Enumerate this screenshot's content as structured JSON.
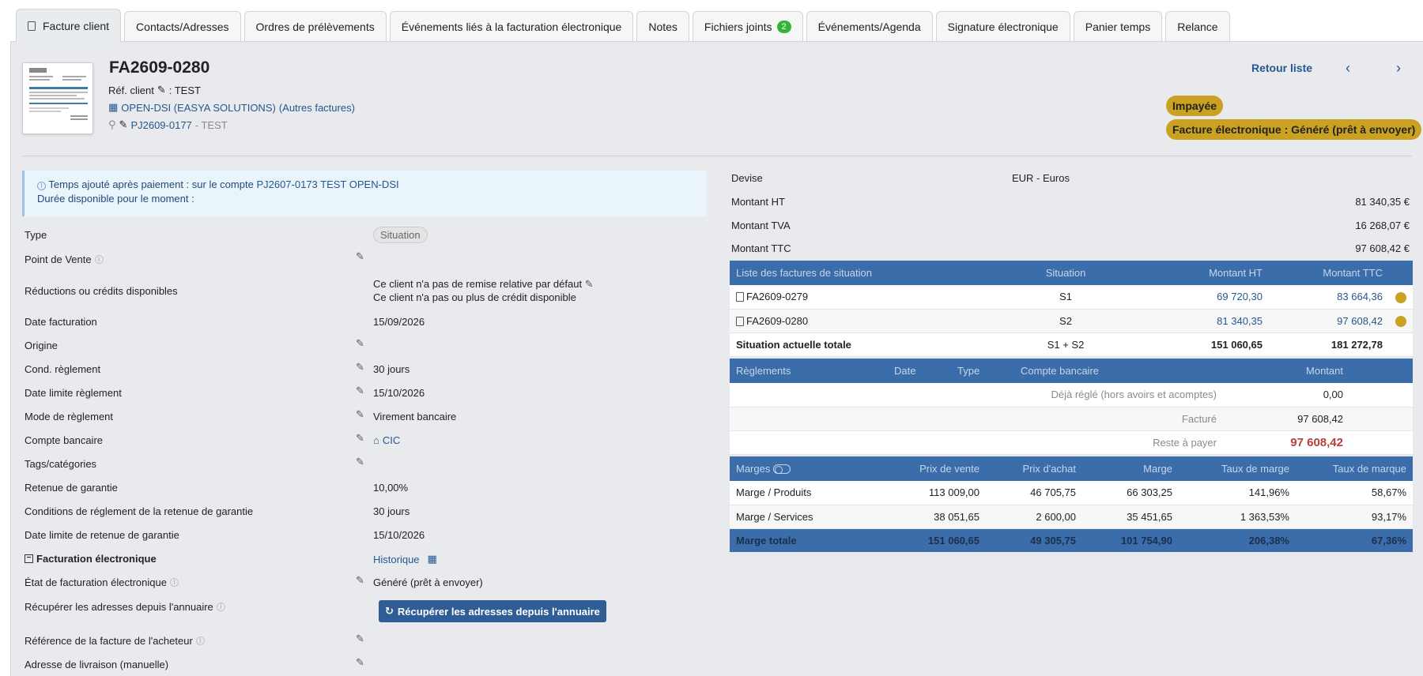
{
  "tabs": [
    {
      "label": "Facture client",
      "active": true
    },
    {
      "label": "Contacts/Adresses"
    },
    {
      "label": "Ordres de prélèvements"
    },
    {
      "label": "Événements liés à la facturation électronique"
    },
    {
      "label": "Notes"
    },
    {
      "label": "Fichiers joints",
      "count": "2"
    },
    {
      "label": "Événements/Agenda"
    },
    {
      "label": "Signature électronique"
    },
    {
      "label": "Panier temps"
    },
    {
      "label": "Relance"
    }
  ],
  "header": {
    "ref": "FA2609-0280",
    "ref_client_label": "Réf. client",
    "ref_client_value": ": TEST",
    "company": "OPEN-DSI (EASYA SOLUTIONS)",
    "other_invoices": "(Autres factures)",
    "project_ref": "PJ2609-0177",
    "project_name": "- TEST",
    "back_link": "Retour liste",
    "prev_icon": "chevron-left-icon",
    "next_icon": "chevron-right-icon",
    "status": "Impayée",
    "einvoice_status": "Facture électronique : Généré (prêt à envoyer)",
    "status_color": "#caa121"
  },
  "info": {
    "line1_prefix": "Temps ajouté après paiement : sur le compte",
    "line1_link": "PJ2607-0173 TEST OPEN-DSI",
    "line2": "Durée disponible pour le moment :"
  },
  "fields": {
    "type_label": "Type",
    "type_value": "Situation",
    "pos_label": "Point de Vente",
    "discount_label": "Réductions ou crédits disponibles",
    "discount_line1": "Ce client n'a pas de remise relative par défaut",
    "discount_line2": "Ce client n'a pas ou plus de crédit disponible",
    "date_label": "Date facturation",
    "date_value": "15/09/2026",
    "origin_label": "Origine",
    "cond_label": "Cond. règlement",
    "cond_value": "30 jours",
    "due_label": "Date limite règlement",
    "due_value": "15/10/2026",
    "mode_label": "Mode de règlement",
    "mode_value": "Virement bancaire",
    "bank_label": "Compte bancaire",
    "bank_value": "CIC",
    "tags_label": "Tags/catégories",
    "ret_label": "Retenue de garantie",
    "ret_value": "10,00%",
    "retcond_label": "Conditions de réglement de la retenue de garantie",
    "retcond_value": "30 jours",
    "retdate_label": "Date limite de retenue de garantie",
    "retdate_value": "15/10/2026",
    "einv_section": "Facturation électronique",
    "einv_history": "Historique",
    "einv_state_label": "État de facturation électronique",
    "einv_state_value": "Généré (prêt à envoyer)",
    "fetch_label": "Récupérer les adresses depuis l'annuaire",
    "fetch_button": "Récupérer les adresses depuis l'annuaire",
    "buyerref_label": "Référence de la facture de l'acheteur",
    "delivery_label": "Adresse de livraison (manuelle)"
  },
  "amounts": {
    "currency_label": "Devise",
    "currency_value": "EUR - Euros",
    "ht_label": "Montant HT",
    "ht_value": "81 340,35 €",
    "tva_label": "Montant TVA",
    "tva_value": "16 268,07 €",
    "ttc_label": "Montant TTC",
    "ttc_value": "97 608,42 €"
  },
  "situations": {
    "headers": [
      "Liste des factures de situation",
      "Situation",
      "Montant HT",
      "Montant TTC"
    ],
    "rows": [
      {
        "ref": "FA2609-0279",
        "situation": "S1",
        "ht": "69 720,30",
        "ttc": "83 664,36"
      },
      {
        "ref": "FA2609-0280",
        "situation": "S2",
        "ht": "81 340,35",
        "ttc": "97 608,42"
      }
    ],
    "total": {
      "label": "Situation actuelle totale",
      "situation": "S1 + S2",
      "ht": "151 060,65",
      "ttc": "181 272,78"
    }
  },
  "payments": {
    "headers": [
      "Règlements",
      "Date",
      "Type",
      "Compte bancaire",
      "Montant"
    ],
    "rows": [
      {
        "label": "Déjà réglé (hors avoirs et acomptes)",
        "value": "0,00"
      },
      {
        "label": "Facturé",
        "value": "97 608,42"
      },
      {
        "label": "Reste à payer",
        "value": "97 608,42"
      }
    ]
  },
  "margins": {
    "headers": [
      "Marges",
      "Prix de vente",
      "Prix d'achat",
      "Marge",
      "Taux de marge",
      "Taux de marque"
    ],
    "rows": [
      [
        "Marge / Produits",
        "113 009,00",
        "46 705,75",
        "66 303,25",
        "141,96%",
        "58,67%"
      ],
      [
        "Marge / Services",
        "38 051,65",
        "2 600,00",
        "35 451,65",
        "1 363,53%",
        "93,17%"
      ]
    ],
    "total": [
      "Marge totale",
      "151 060,65",
      "49 305,75",
      "101 754,90",
      "206,38%",
      "67,36%"
    ]
  }
}
